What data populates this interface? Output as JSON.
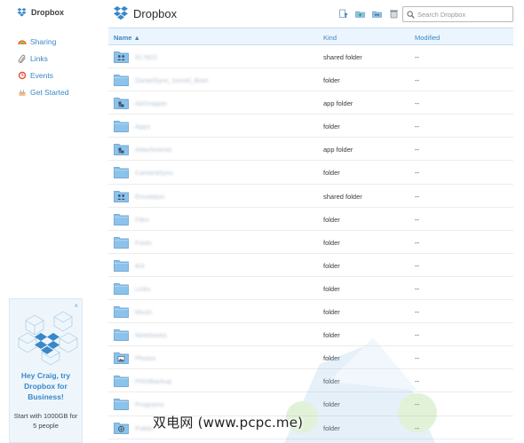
{
  "sidebar": {
    "brand": "Dropbox",
    "nav": [
      {
        "label": "Sharing",
        "icon": "rainbow-icon"
      },
      {
        "label": "Links",
        "icon": "paperclip-icon"
      },
      {
        "label": "Events",
        "icon": "clock-icon"
      },
      {
        "label": "Get Started",
        "icon": "cake-icon"
      }
    ],
    "promo": {
      "title": "Hey Craig, try Dropbox for Business!",
      "subtitle": "Start with 1000GB for 5 people",
      "close": "×"
    }
  },
  "header": {
    "title": "Dropbox",
    "search_placeholder": "Search Dropbox",
    "tools": [
      "upload-icon",
      "new-folder-icon",
      "share-folder-icon",
      "deleted-files-icon"
    ]
  },
  "table": {
    "columns": {
      "name": "Name ▲",
      "kind": "Kind",
      "modified": "Modified"
    },
    "rows": [
      {
        "name": "917822",
        "kind": "shared folder",
        "modified": "--",
        "icon": "shared"
      },
      {
        "name": "DanielSync_tunnel_Boot",
        "kind": "folder",
        "modified": "--",
        "icon": "folder"
      },
      {
        "name": "AirDropper",
        "kind": "app folder",
        "modified": "--",
        "icon": "app"
      },
      {
        "name": "Apps",
        "kind": "folder",
        "modified": "--",
        "icon": "folder"
      },
      {
        "name": "Attachments",
        "kind": "app folder",
        "modified": "--",
        "icon": "app"
      },
      {
        "name": "CameraSync",
        "kind": "folder",
        "modified": "--",
        "icon": "folder"
      },
      {
        "name": "Emulation",
        "kind": "shared folder",
        "modified": "--",
        "icon": "shared"
      },
      {
        "name": "Files",
        "kind": "folder",
        "modified": "--",
        "icon": "folder"
      },
      {
        "name": "Fonts",
        "kind": "folder",
        "modified": "--",
        "icon": "folder"
      },
      {
        "name": "iKit",
        "kind": "folder",
        "modified": "--",
        "icon": "folder"
      },
      {
        "name": "Links",
        "kind": "folder",
        "modified": "--",
        "icon": "folder"
      },
      {
        "name": "Music",
        "kind": "folder",
        "modified": "--",
        "icon": "folder"
      },
      {
        "name": "Notebooks",
        "kind": "folder",
        "modified": "--",
        "icon": "folder"
      },
      {
        "name": "Photos",
        "kind": "folder",
        "modified": "--",
        "icon": "photos"
      },
      {
        "name": "PROBackup",
        "kind": "folder",
        "modified": "--",
        "icon": "folder"
      },
      {
        "name": "Programs",
        "kind": "folder",
        "modified": "--",
        "icon": "folder"
      },
      {
        "name": "Public",
        "kind": "folder",
        "modified": "--",
        "icon": "public"
      }
    ]
  },
  "watermark": "双电网 (www.pcpc.me)",
  "colors": {
    "accent": "#3a87c8",
    "folder": "#8cc3ec",
    "header_bg": "#ecf5fd"
  }
}
